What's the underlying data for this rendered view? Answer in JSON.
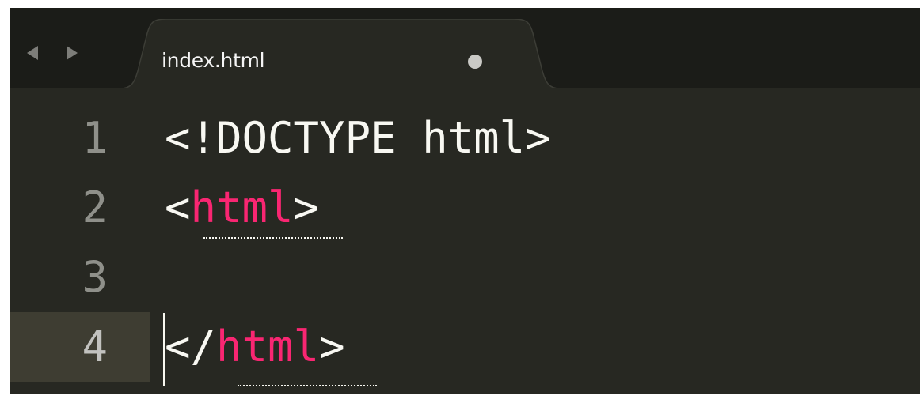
{
  "tab": {
    "filename": "index.html",
    "unsaved": true
  },
  "nav": {
    "back_icon": "triangle-left-icon",
    "forward_icon": "triangle-right-icon"
  },
  "editor": {
    "current_line": 4,
    "lines": [
      {
        "number": "1",
        "parts": [
          "<!DOCTYPE html>"
        ]
      },
      {
        "number": "2",
        "parts": [
          "<",
          "html",
          ">"
        ]
      },
      {
        "number": "3",
        "parts": []
      },
      {
        "number": "4",
        "parts": [
          "</",
          "html",
          ">"
        ]
      }
    ]
  },
  "colors": {
    "background": "#272822",
    "tabbar": "#1b1c18",
    "tab": "#272822",
    "text": "#f8f8f2",
    "tag": "#f92672",
    "line_number": "#8f908a",
    "current_line_gutter": "#3e3d32"
  }
}
